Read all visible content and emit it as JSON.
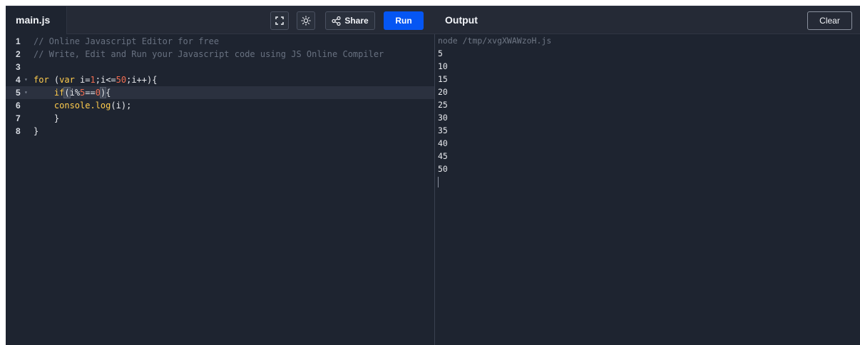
{
  "editor": {
    "tab_label": "main.js",
    "lines": [
      {
        "num": "1",
        "fold": "",
        "tokens": [
          {
            "t": "comment",
            "v": "// Online Javascript Editor for free"
          }
        ]
      },
      {
        "num": "2",
        "fold": "",
        "tokens": [
          {
            "t": "comment",
            "v": "// Write, Edit and Run your Javascript code using JS Online Compiler"
          }
        ]
      },
      {
        "num": "3",
        "fold": "",
        "tokens": []
      },
      {
        "num": "4",
        "fold": "▾",
        "tokens": [
          {
            "t": "kw",
            "v": "for"
          },
          {
            "t": "plain",
            "v": " ("
          },
          {
            "t": "kw",
            "v": "var"
          },
          {
            "t": "plain",
            "v": " i="
          },
          {
            "t": "num",
            "v": "1"
          },
          {
            "t": "plain",
            "v": ";i<="
          },
          {
            "t": "num",
            "v": "50"
          },
          {
            "t": "plain",
            "v": ";i++){"
          }
        ]
      },
      {
        "num": "5",
        "fold": "▾",
        "active": true,
        "tokens": [
          {
            "t": "plain",
            "v": "    "
          },
          {
            "t": "kw",
            "v": "if"
          },
          {
            "t": "hl",
            "v": "("
          },
          {
            "t": "plain",
            "v": "i%"
          },
          {
            "t": "num",
            "v": "5"
          },
          {
            "t": "plain",
            "v": "=="
          },
          {
            "t": "num",
            "v": "0"
          },
          {
            "t": "hl",
            "v": ")"
          },
          {
            "t": "plain",
            "v": "{"
          }
        ]
      },
      {
        "num": "6",
        "fold": "",
        "tokens": [
          {
            "t": "plain",
            "v": "    "
          },
          {
            "t": "kw",
            "v": "console.log"
          },
          {
            "t": "plain",
            "v": "(i);"
          }
        ]
      },
      {
        "num": "7",
        "fold": "",
        "tokens": [
          {
            "t": "plain",
            "v": "    }"
          }
        ]
      },
      {
        "num": "8",
        "fold": "",
        "tokens": [
          {
            "t": "plain",
            "v": "}"
          }
        ]
      }
    ]
  },
  "toolbar": {
    "fullscreen_icon": "fullscreen-icon",
    "theme_icon": "sun-icon",
    "share_icon": "share-icon",
    "share_label": "Share",
    "run_label": "Run",
    "run_color": "#0556f3"
  },
  "output": {
    "title": "Output",
    "clear_label": "Clear",
    "command": "node /tmp/xvgXWAWzoH.js",
    "lines": [
      "5",
      "10",
      "15",
      "20",
      "25",
      "30",
      "35",
      "40",
      "45",
      "50"
    ]
  },
  "colors": {
    "background": "#1e2430",
    "toolbar": "#252a36",
    "keyword": "#ffcc4d",
    "number": "#f06c50",
    "comment": "#687180"
  }
}
